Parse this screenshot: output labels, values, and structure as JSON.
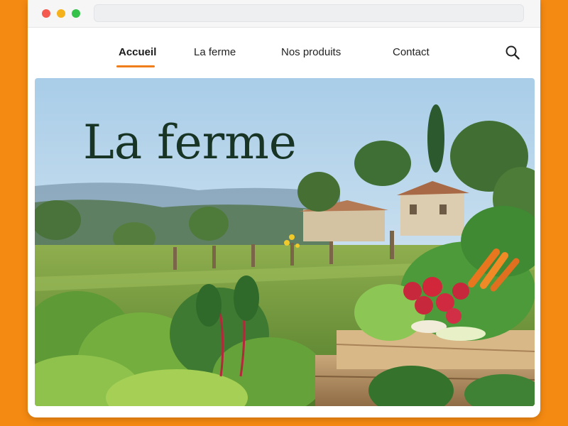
{
  "nav": {
    "items": [
      {
        "label": "Accueil",
        "active": true
      },
      {
        "label": "La ferme",
        "active": false
      },
      {
        "label": "Nos produits",
        "active": false
      },
      {
        "label": "Contact",
        "active": false
      }
    ]
  },
  "hero": {
    "title": "La ferme"
  },
  "colors": {
    "background": "#f58a12",
    "accent": "#ef7d1a",
    "title": "#173424"
  },
  "icons": [
    "search-icon"
  ]
}
